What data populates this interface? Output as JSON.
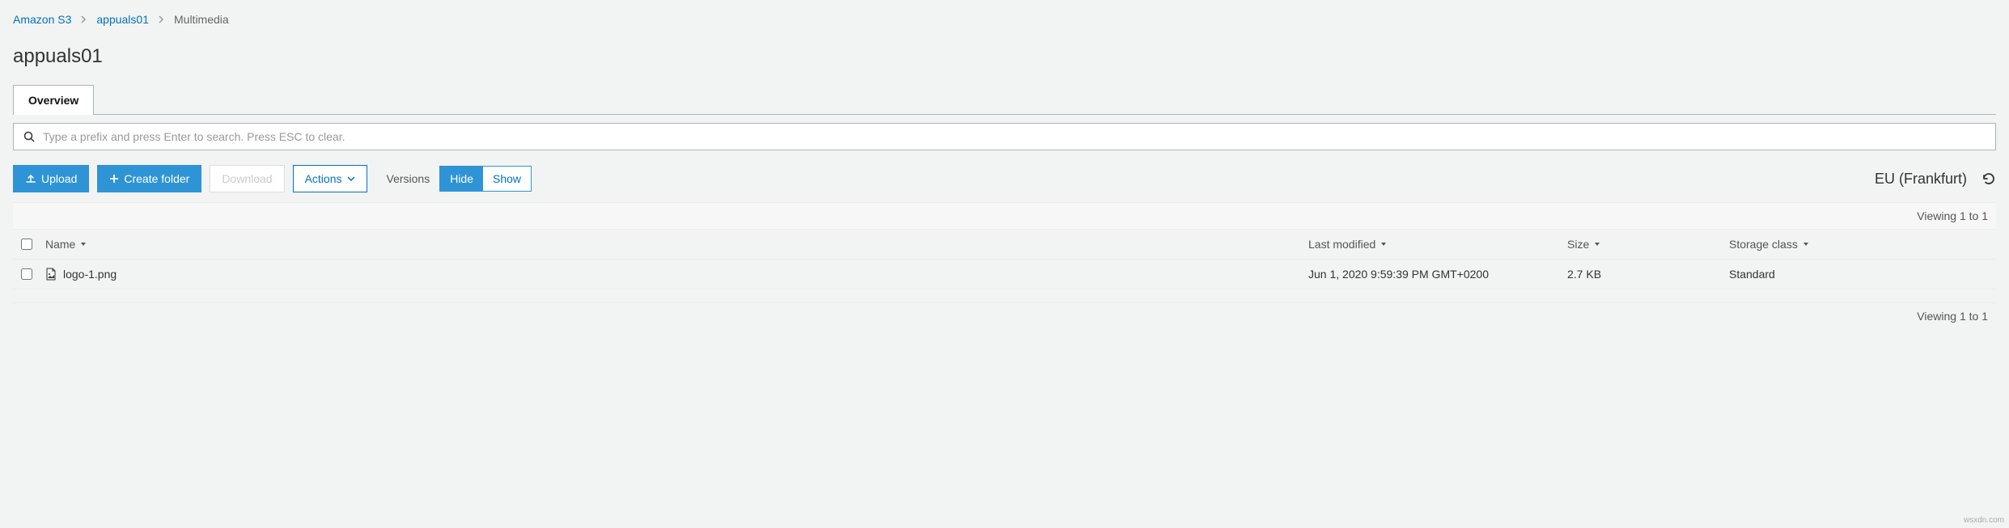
{
  "breadcrumb": {
    "root": "Amazon S3",
    "bucket": "appuals01",
    "folder": "Multimedia"
  },
  "page": {
    "title": "appuals01"
  },
  "tabs": {
    "overview": "Overview"
  },
  "search": {
    "placeholder": "Type a prefix and press Enter to search. Press ESC to clear."
  },
  "toolbar": {
    "upload": "Upload",
    "create_folder": "Create folder",
    "download": "Download",
    "actions": "Actions",
    "versions_label": "Versions",
    "hide": "Hide",
    "show": "Show",
    "region": "EU (Frankfurt)"
  },
  "pagination": {
    "top_text": "Viewing 1 to 1",
    "bottom_text": "Viewing 1 to 1"
  },
  "columns": {
    "name": "Name",
    "last_modified": "Last modified",
    "size": "Size",
    "storage_class": "Storage class"
  },
  "rows": [
    {
      "name": "logo-1.png",
      "last_modified": "Jun 1, 2020 9:59:39 PM GMT+0200",
      "size": "2.7 KB",
      "storage_class": "Standard"
    }
  ],
  "watermark": "wsxdn.com"
}
